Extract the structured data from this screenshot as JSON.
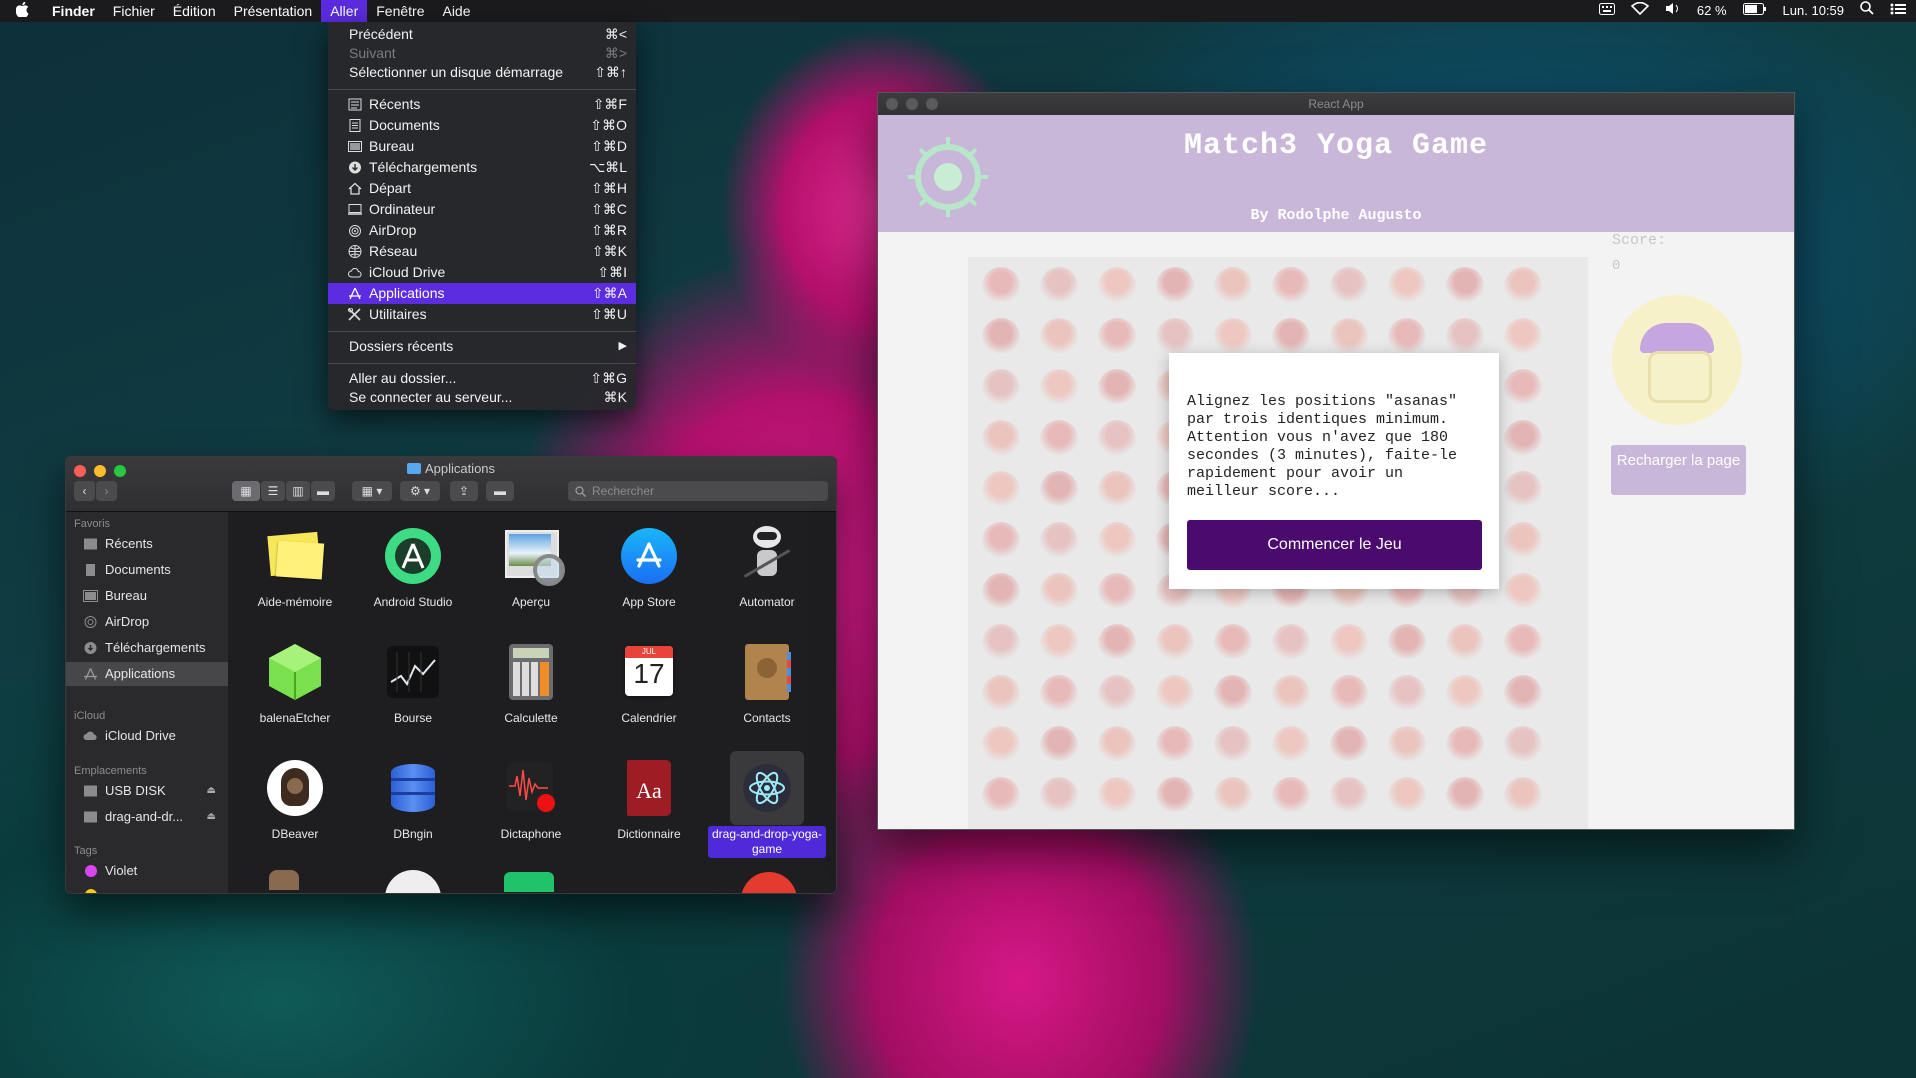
{
  "menubar": {
    "app": "Finder",
    "menus": [
      "Fichier",
      "Édition",
      "Présentation",
      "Aller",
      "Fenêtre",
      "Aide"
    ],
    "status": {
      "battery": "62 %",
      "clock": "Lun. 10:59"
    }
  },
  "go_menu": {
    "items": [
      {
        "label": "Précédent",
        "shortcut": "⌘<",
        "enabled": true
      },
      {
        "label": "Suivant",
        "shortcut": "⌘>",
        "enabled": false
      },
      {
        "label": "Sélectionner un disque démarrage",
        "shortcut": "⇧⌘↑",
        "enabled": true
      },
      {
        "label": "Récents",
        "shortcut": "⇧⌘F",
        "icon": "recents-icon"
      },
      {
        "label": "Documents",
        "shortcut": "⇧⌘O",
        "icon": "documents-icon"
      },
      {
        "label": "Bureau",
        "shortcut": "⇧⌘D",
        "icon": "desktop-icon"
      },
      {
        "label": "Téléchargements",
        "shortcut": "⌥⌘L",
        "icon": "downloads-icon"
      },
      {
        "label": "Départ",
        "shortcut": "⇧⌘H",
        "icon": "home-icon"
      },
      {
        "label": "Ordinateur",
        "shortcut": "⇧⌘C",
        "icon": "computer-icon"
      },
      {
        "label": "AirDrop",
        "shortcut": "⇧⌘R",
        "icon": "airdrop-icon"
      },
      {
        "label": "Réseau",
        "shortcut": "⇧⌘K",
        "icon": "network-icon"
      },
      {
        "label": "iCloud Drive",
        "shortcut": "⇧⌘I",
        "icon": "icloud-icon"
      },
      {
        "label": "Applications",
        "shortcut": "⇧⌘A",
        "icon": "applications-icon",
        "highlighted": true
      },
      {
        "label": "Utilitaires",
        "shortcut": "⇧⌘U",
        "icon": "utilities-icon"
      },
      {
        "label": "Dossiers récents",
        "shortcut": "▶"
      },
      {
        "label": "Aller au dossier...",
        "shortcut": "⇧⌘G"
      },
      {
        "label": "Se connecter au serveur...",
        "shortcut": "⌘K"
      }
    ]
  },
  "finder": {
    "title": "Applications",
    "search_placeholder": "Rechercher",
    "sidebar": {
      "favoris_header": "Favoris",
      "favoris": [
        "Récents",
        "Documents",
        "Bureau",
        "AirDrop",
        "Téléchargements",
        "Applications"
      ],
      "icloud_header": "iCloud",
      "icloud": [
        "iCloud Drive"
      ],
      "emplacements_header": "Emplacements",
      "emplacements": [
        "USB DISK",
        "drag-and-dr..."
      ],
      "tags_header": "Tags",
      "tags": [
        "Violet"
      ]
    },
    "apps": [
      "Aide-mémoire",
      "Android Studio",
      "Aperçu",
      "App Store",
      "Automator",
      "balenaEtcher",
      "Bourse",
      "Calculette",
      "Calendrier",
      "Contacts",
      "DBeaver",
      "DBngin",
      "Dictaphone",
      "Dictionnaire",
      "drag-and-drop-yoga-game"
    ],
    "calendar_icon": {
      "month": "JUL",
      "day": "17"
    },
    "dictionary_icon_text": "Aa"
  },
  "react_app": {
    "window_title": "React App",
    "game_title": "Match3 Yoga Game",
    "byline": "By Rodolphe Augusto",
    "score_label": "Score:",
    "score_value": "0",
    "modal_text": "Alignez les positions \"asanas\"\npar trois identiques minimum.\nAttention vous n'avez que 180\nsecondes (3 minutes), faite-le\nrapidement pour avoir un\nmeilleur score...",
    "start_button": "Commencer le Jeu",
    "reload_button": "Recharger la page"
  },
  "colors": {
    "menu_highlight": "#5b2ce0",
    "header_purple": "#c9b7d9",
    "start_button": "#4a0a6e",
    "tag_violet": "#d946ef"
  }
}
